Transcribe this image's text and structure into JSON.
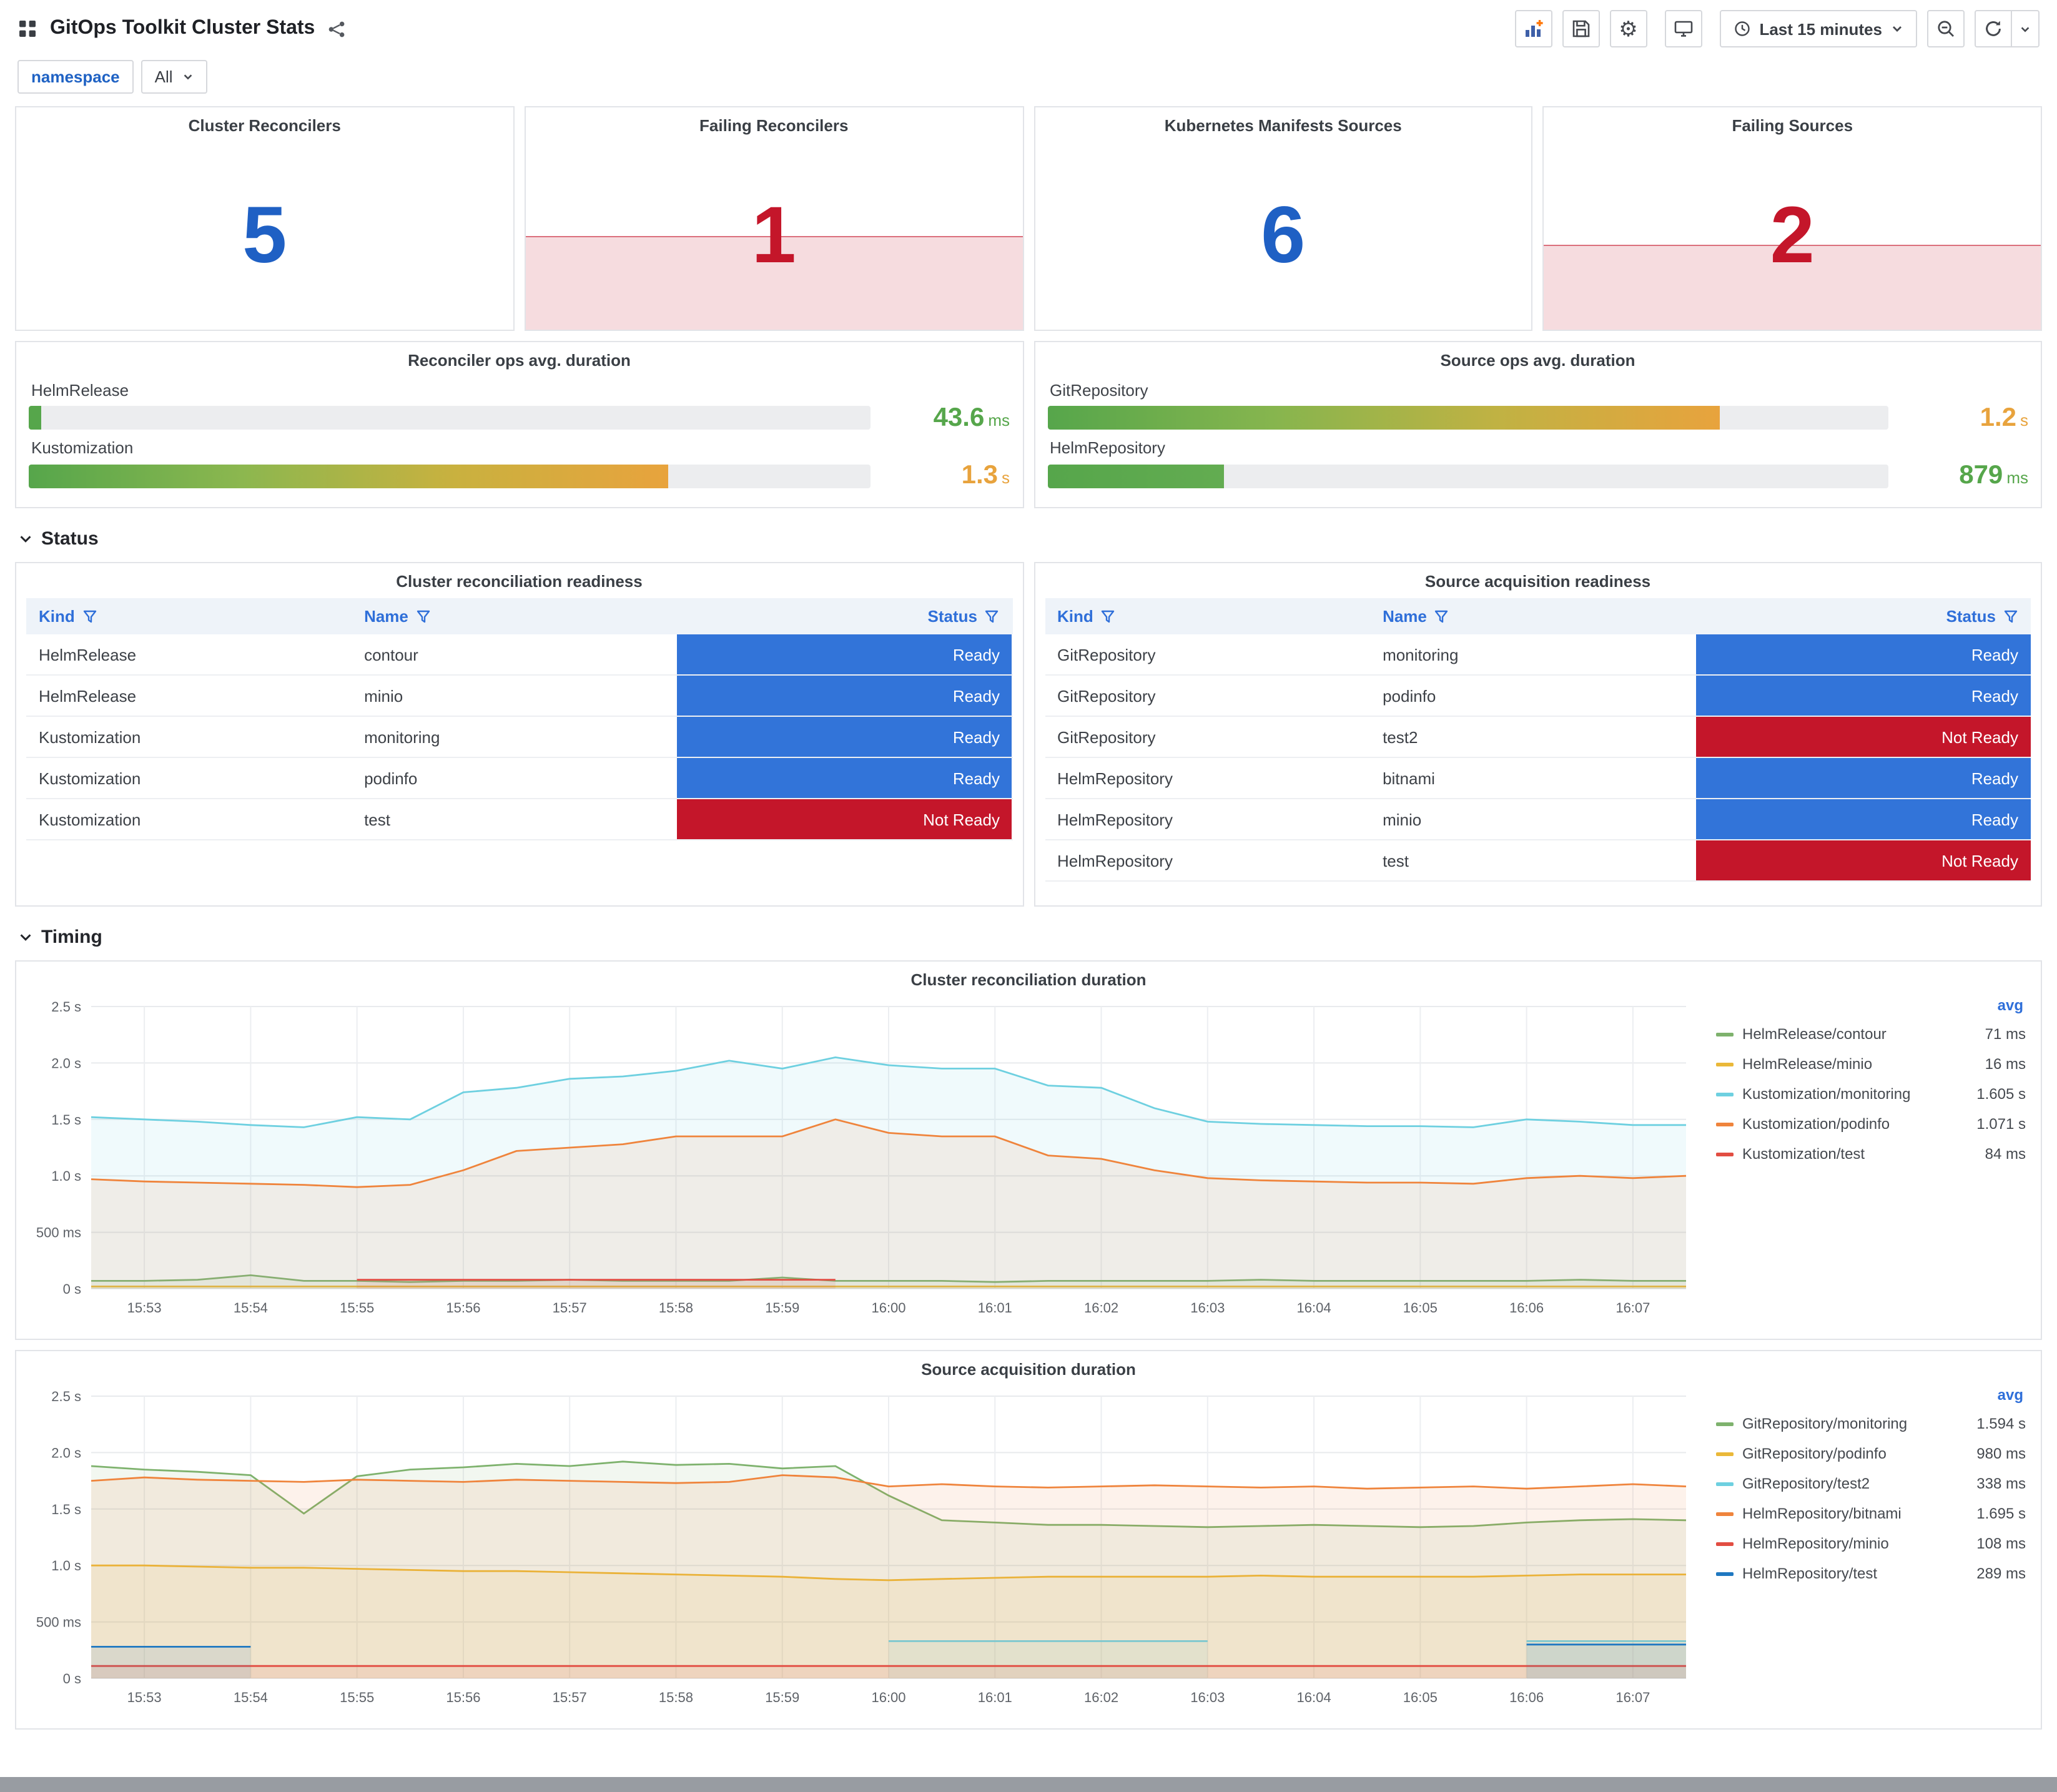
{
  "header": {
    "title": "GitOps Toolkit Cluster Stats",
    "time_picker": "Last 15 minutes"
  },
  "variables": {
    "label": "namespace",
    "value": "All"
  },
  "rows": [
    {
      "label": "Status"
    },
    {
      "label": "Timing"
    }
  ],
  "stat_panels": [
    {
      "title": "Cluster Reconcilers",
      "value": "5",
      "color": "#1F60C4",
      "sparkline": false,
      "spark_pct": 0
    },
    {
      "title": "Failing Reconcilers",
      "value": "1",
      "color": "#C4162A",
      "sparkline": true,
      "spark_pct": 42
    },
    {
      "title": "Kubernetes Manifests Sources",
      "value": "6",
      "color": "#1F60C4",
      "sparkline": false,
      "spark_pct": 0
    },
    {
      "title": "Failing Sources",
      "value": "2",
      "color": "#C4162A",
      "sparkline": true,
      "spark_pct": 38
    }
  ],
  "gauge_panels": [
    {
      "title": "Reconciler ops avg. duration",
      "rows": [
        {
          "label": "HelmRelease",
          "value": "43.6",
          "unit": "ms",
          "percent": 1.5,
          "value_color": "#56A64B",
          "bar": [
            "#56A64B"
          ]
        },
        {
          "label": "Kustomization",
          "value": "1.3",
          "unit": "s",
          "percent": 76,
          "value_color": "#E8A33D",
          "bar": [
            "#56A64B",
            "#8CB74F",
            "#C9B13F",
            "#E8A33D"
          ]
        }
      ]
    },
    {
      "title": "Source ops avg. duration",
      "rows": [
        {
          "label": "GitRepository",
          "value": "1.2",
          "unit": "s",
          "percent": 80,
          "value_color": "#E8A33D",
          "bar": [
            "#56A64B",
            "#86B54E",
            "#C0B243",
            "#E8A33D"
          ]
        },
        {
          "label": "HelmRepository",
          "value": "879",
          "unit": "ms",
          "percent": 21,
          "value_color": "#56A64B",
          "bar": [
            "#56A64B",
            "#63AC51"
          ]
        }
      ]
    }
  ],
  "status_colors": {
    "Ready": "#3274D9",
    "Not Ready": "#C4162A"
  },
  "tables": [
    {
      "title": "Cluster reconciliation readiness",
      "columns": [
        "Kind",
        "Name",
        "Status"
      ],
      "rows": [
        {
          "kind": "HelmRelease",
          "name": "contour",
          "status": "Ready"
        },
        {
          "kind": "HelmRelease",
          "name": "minio",
          "status": "Ready"
        },
        {
          "kind": "Kustomization",
          "name": "monitoring",
          "status": "Ready"
        },
        {
          "kind": "Kustomization",
          "name": "podinfo",
          "status": "Ready"
        },
        {
          "kind": "Kustomization",
          "name": "test",
          "status": "Not Ready"
        }
      ]
    },
    {
      "title": "Source acquisition readiness",
      "columns": [
        "Kind",
        "Name",
        "Status"
      ],
      "rows": [
        {
          "kind": "GitRepository",
          "name": "monitoring",
          "status": "Ready"
        },
        {
          "kind": "GitRepository",
          "name": "podinfo",
          "status": "Ready"
        },
        {
          "kind": "GitRepository",
          "name": "test2",
          "status": "Not Ready"
        },
        {
          "kind": "HelmRepository",
          "name": "bitnami",
          "status": "Ready"
        },
        {
          "kind": "HelmRepository",
          "name": "minio",
          "status": "Ready"
        },
        {
          "kind": "HelmRepository",
          "name": "test",
          "status": "Not Ready"
        }
      ]
    }
  ],
  "chart_data": [
    {
      "type": "line",
      "title": "Cluster reconciliation duration",
      "legend_header": "avg",
      "ylim": [
        0,
        2.5
      ],
      "y_ticks": [
        "0 s",
        "500 ms",
        "1.0 s",
        "1.5 s",
        "2.0 s",
        "2.5 s"
      ],
      "x_ticks": [
        "15:53",
        "15:54",
        "15:55",
        "15:56",
        "15:57",
        "15:58",
        "15:59",
        "16:00",
        "16:01",
        "16:02",
        "16:03",
        "16:04",
        "16:05",
        "16:06",
        "16:07"
      ],
      "series": [
        {
          "name": "HelmRelease/contour",
          "avg": "71 ms",
          "color": "#7EB26D",
          "values": [
            0.07,
            0.07,
            0.08,
            0.12,
            0.07,
            0.07,
            0.06,
            0.07,
            0.07,
            0.08,
            0.07,
            0.07,
            0.07,
            0.1,
            0.07,
            0.07,
            0.07,
            0.06,
            0.07,
            0.07,
            0.07,
            0.07,
            0.08,
            0.07,
            0.07,
            0.07,
            0.07,
            0.07,
            0.08,
            0.07,
            0.07
          ]
        },
        {
          "name": "HelmRelease/minio",
          "avg": "16 ms",
          "color": "#EAB839",
          "values": [
            0.02,
            0.02,
            0.02,
            0.02,
            0.02,
            0.02,
            0.02,
            0.02,
            0.02,
            0.02,
            0.02,
            0.02,
            0.02,
            0.02,
            0.02,
            0.02,
            0.02,
            0.02,
            0.02,
            0.02,
            0.02,
            0.02,
            0.02,
            0.02,
            0.02,
            0.02,
            0.02,
            0.02,
            0.02,
            0.02,
            0.02
          ]
        },
        {
          "name": "Kustomization/monitoring",
          "avg": "1.605 s",
          "color": "#6ED0E0",
          "values": [
            1.52,
            1.5,
            1.48,
            1.45,
            1.43,
            1.52,
            1.5,
            1.74,
            1.78,
            1.86,
            1.88,
            1.93,
            2.02,
            1.95,
            2.05,
            1.98,
            1.95,
            1.95,
            1.8,
            1.78,
            1.6,
            1.48,
            1.46,
            1.45,
            1.44,
            1.44,
            1.43,
            1.5,
            1.48,
            1.45,
            1.45
          ]
        },
        {
          "name": "Kustomization/podinfo",
          "avg": "1.071 s",
          "color": "#EF843C",
          "values": [
            0.97,
            0.95,
            0.94,
            0.93,
            0.92,
            0.9,
            0.92,
            1.05,
            1.22,
            1.25,
            1.28,
            1.35,
            1.35,
            1.35,
            1.5,
            1.38,
            1.35,
            1.35,
            1.18,
            1.15,
            1.05,
            0.98,
            0.96,
            0.95,
            0.94,
            0.94,
            0.93,
            0.98,
            1.0,
            0.98,
            1.0
          ]
        },
        {
          "name": "Kustomization/test",
          "avg": "84 ms",
          "color": "#E24D42",
          "values": [
            null,
            null,
            null,
            null,
            null,
            0.08,
            0.08,
            0.08,
            0.08,
            0.08,
            0.08,
            0.08,
            0.08,
            0.08,
            0.08,
            null,
            null,
            null,
            null,
            null,
            null,
            null,
            null,
            null,
            null,
            null,
            null,
            null,
            null,
            null,
            null
          ]
        }
      ]
    },
    {
      "type": "line",
      "title": "Source acquisition duration",
      "legend_header": "avg",
      "ylim": [
        0,
        2.5
      ],
      "y_ticks": [
        "0 s",
        "500 ms",
        "1.0 s",
        "1.5 s",
        "2.0 s",
        "2.5 s"
      ],
      "x_ticks": [
        "15:53",
        "15:54",
        "15:55",
        "15:56",
        "15:57",
        "15:58",
        "15:59",
        "16:00",
        "16:01",
        "16:02",
        "16:03",
        "16:04",
        "16:05",
        "16:06",
        "16:07"
      ],
      "series": [
        {
          "name": "GitRepository/monitoring",
          "avg": "1.594 s",
          "color": "#7EB26D",
          "values": [
            1.88,
            1.85,
            1.83,
            1.8,
            1.46,
            1.79,
            1.85,
            1.87,
            1.9,
            1.88,
            1.92,
            1.89,
            1.9,
            1.86,
            1.88,
            1.62,
            1.4,
            1.38,
            1.36,
            1.36,
            1.35,
            1.34,
            1.35,
            1.36,
            1.35,
            1.34,
            1.35,
            1.38,
            1.4,
            1.41,
            1.4
          ]
        },
        {
          "name": "GitRepository/podinfo",
          "avg": "980 ms",
          "color": "#EAB839",
          "values": [
            1.0,
            1.0,
            0.99,
            0.98,
            0.98,
            0.97,
            0.96,
            0.95,
            0.95,
            0.94,
            0.93,
            0.92,
            0.91,
            0.9,
            0.88,
            0.87,
            0.88,
            0.89,
            0.9,
            0.9,
            0.9,
            0.9,
            0.91,
            0.9,
            0.9,
            0.9,
            0.9,
            0.91,
            0.92,
            0.92,
            0.92
          ]
        },
        {
          "name": "GitRepository/test2",
          "avg": "338 ms",
          "color": "#6ED0E0",
          "values": [
            null,
            null,
            null,
            null,
            null,
            null,
            null,
            null,
            null,
            null,
            null,
            null,
            null,
            null,
            null,
            0.33,
            0.33,
            0.33,
            0.33,
            0.33,
            0.33,
            0.33,
            null,
            null,
            null,
            null,
            null,
            0.33,
            0.33,
            0.33,
            0.33
          ]
        },
        {
          "name": "HelmRepository/bitnami",
          "avg": "1.695 s",
          "color": "#EF843C",
          "values": [
            1.75,
            1.78,
            1.76,
            1.75,
            1.74,
            1.76,
            1.75,
            1.74,
            1.76,
            1.75,
            1.74,
            1.73,
            1.74,
            1.8,
            1.78,
            1.7,
            1.72,
            1.7,
            1.69,
            1.7,
            1.71,
            1.7,
            1.69,
            1.7,
            1.68,
            1.69,
            1.7,
            1.68,
            1.7,
            1.72,
            1.7
          ]
        },
        {
          "name": "HelmRepository/minio",
          "avg": "108 ms",
          "color": "#E24D42",
          "values": [
            0.11,
            0.11,
            0.11,
            0.11,
            0.11,
            0.11,
            0.11,
            0.11,
            0.11,
            0.11,
            0.11,
            0.11,
            0.11,
            0.11,
            0.11,
            0.11,
            0.11,
            0.11,
            0.11,
            0.11,
            0.11,
            0.11,
            0.11,
            0.11,
            0.11,
            0.11,
            0.11,
            0.11,
            0.11,
            0.11,
            0.11
          ]
        },
        {
          "name": "HelmRepository/test",
          "avg": "289 ms",
          "color": "#1F78C1",
          "values": [
            0.28,
            0.28,
            0.28,
            0.28,
            null,
            null,
            null,
            null,
            null,
            null,
            null,
            null,
            null,
            null,
            null,
            null,
            null,
            null,
            null,
            null,
            null,
            null,
            null,
            null,
            null,
            null,
            null,
            0.3,
            0.3,
            0.3,
            0.3
          ]
        }
      ]
    }
  ]
}
